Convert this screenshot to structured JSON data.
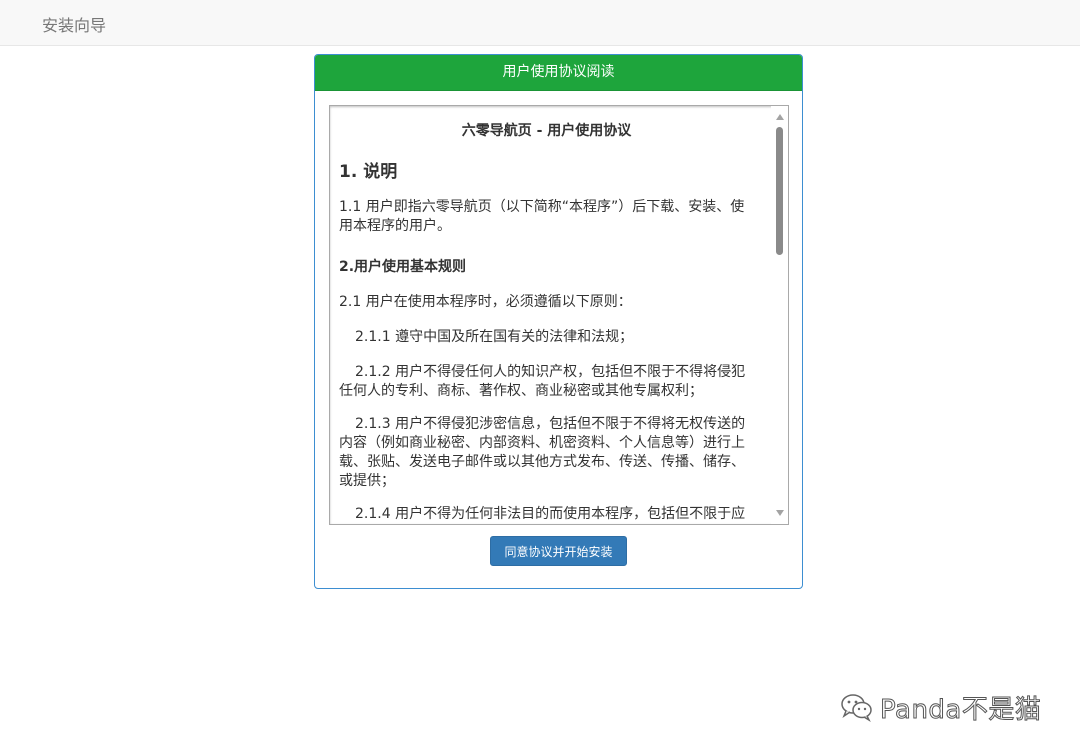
{
  "navbar": {
    "brand": "安装向导"
  },
  "panel": {
    "title": "用户使用协议阅读",
    "agreement": {
      "doc_title": "六零导航页 - 用户使用协议",
      "section1_heading": "1. 说明",
      "section1_p1": "1.1 用户即指六零导航页（以下简称“本程序”）后下载、安装、使用本程序的用户。",
      "section2_heading": "2.用户使用基本规则",
      "section2_p1": "2.1 用户在使用本程序时，必须遵循以下原则：",
      "section2_p1_1": "2.1.1 遵守中国及所在国有关的法律和法规；",
      "section2_p1_2": "2.1.2 用户不得侵任何人的知识产权，包括但不限于不得将侵犯任何人的专利、商标、著作权、商业秘密或其他专属权利；",
      "section2_p1_3": "2.1.3 用户不得侵犯涉密信息，包括但不限于不得将无权传送的内容（例如商业秘密、内部资料、机密资料、个人信息等）进行上载、张贴、发送电子邮件或以其他方式发布、传送、传播、储存、或提供；",
      "section2_p1_4": "2.1.4 用户不得为任何非法目的而使用本程序，包括但不限于应"
    },
    "agree_button": "同意协议并开始安装"
  },
  "watermark": {
    "text": "Panda不是猫",
    "icon": "wechat-icon"
  }
}
